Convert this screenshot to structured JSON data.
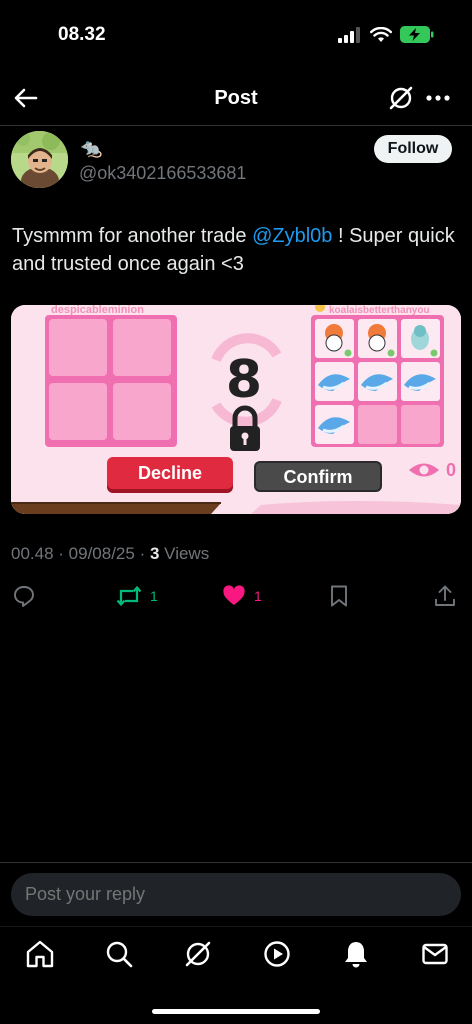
{
  "status_bar": {
    "time": "08.32"
  },
  "header": {
    "title": "Post"
  },
  "author": {
    "name_emoji": "🐀",
    "handle": "@ok3402166533681"
  },
  "follow_label": "Follow",
  "post": {
    "text_before": "Tysmmm for another trade ",
    "mention": "@Zybl0b",
    "text_after": " ! Super quick and trusted once again <3"
  },
  "trade_image": {
    "left_user": "despicableminion",
    "right_user": "koalaisbetterthanyou",
    "countdown": "8",
    "decline_label": "Decline",
    "confirm_label": "Confirm",
    "viewers": "0"
  },
  "meta": {
    "time": "00.48",
    "date": "09/08/25",
    "views_count": "3",
    "views_label": "Views"
  },
  "actions": {
    "retweets": "1",
    "likes": "1"
  },
  "reply": {
    "placeholder": "Post your reply"
  },
  "colors": {
    "accent": "#1d9bf0",
    "retweet": "#00ba7c",
    "like": "#f91880",
    "background": "#000000"
  }
}
